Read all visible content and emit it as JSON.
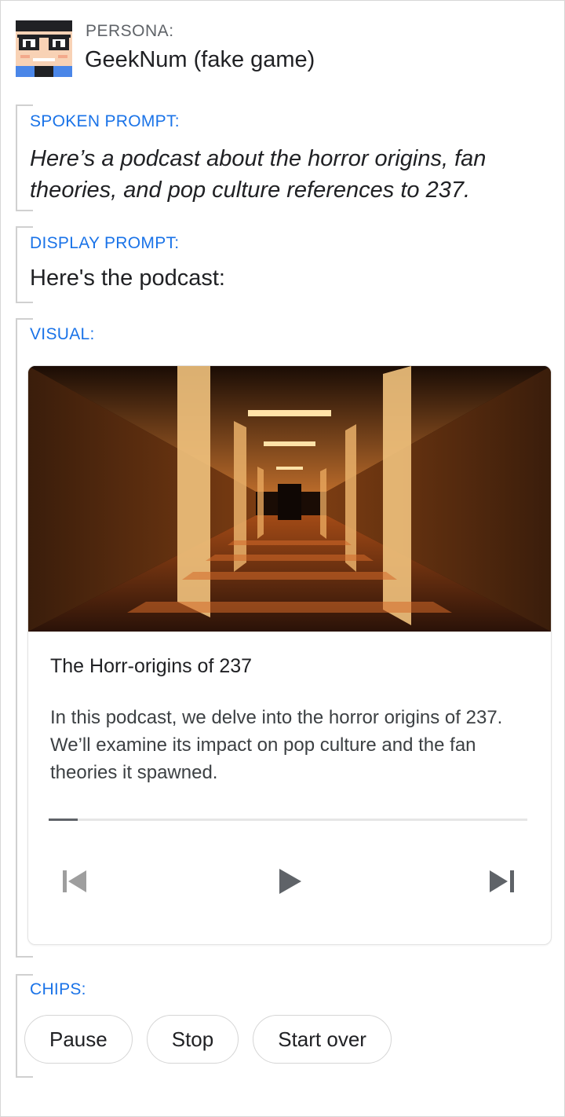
{
  "persona": {
    "label": "PERSONA:",
    "name": "GeekNum (fake game)",
    "avatar_icon": "geek-face-icon"
  },
  "sections": {
    "spoken_label": "SPOKEN PROMPT:",
    "display_label": "DISPLAY PROMPT:",
    "visual_label": "VISUAL:",
    "chips_label": "CHIPS:"
  },
  "spoken_prompt": "Here’s a podcast about the horror origins, fan theories, and pop culture references to 237.",
  "display_prompt": "Here's the podcast:",
  "card": {
    "title": "The Horr-origins of 237",
    "description": "In this podcast, we delve into the horror origins of 237. We’ll examine its impact on pop culture and the fan theories it spawned.",
    "progress_percent": 6,
    "controls": [
      "skip-previous-icon",
      "play-icon",
      "skip-next-icon"
    ]
  },
  "chips": [
    "Pause",
    "Stop",
    "Start over"
  ],
  "colors": {
    "accent_blue": "#1a73e8",
    "text": "#202124",
    "secondary_text": "#5f6368",
    "border": "#d5d5d5"
  }
}
